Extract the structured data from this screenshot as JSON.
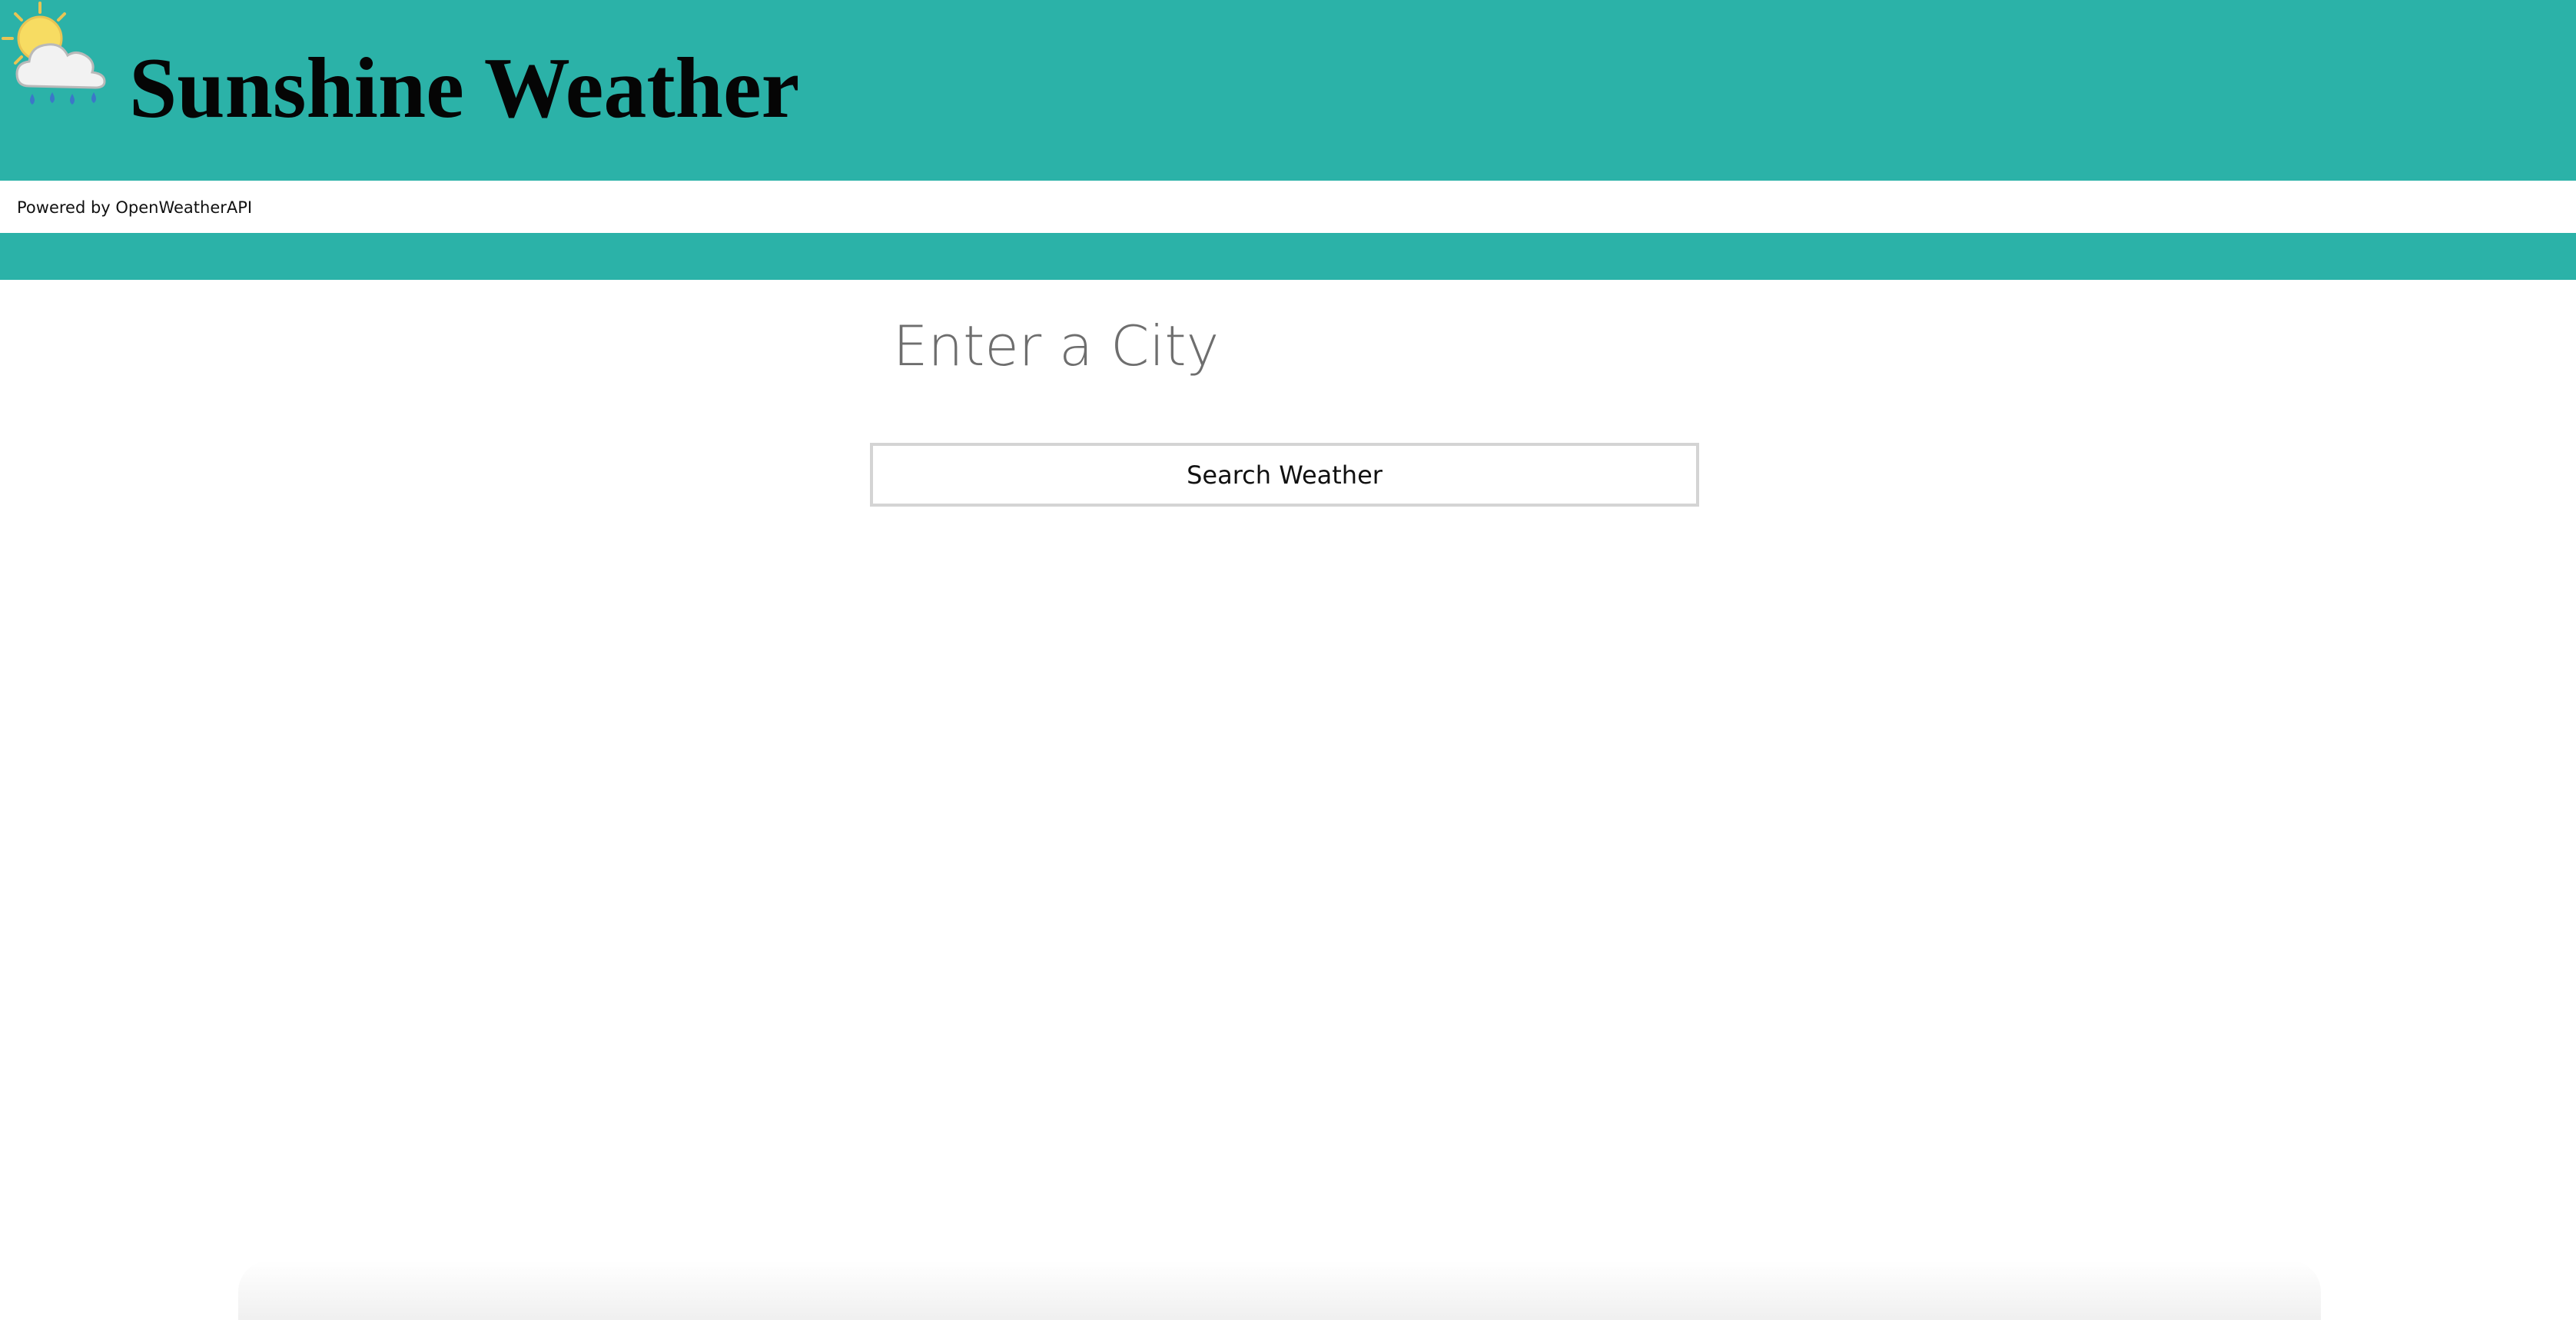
{
  "header": {
    "title": "Sunshine Weather",
    "logo_icon": "sun-cloud-rain-icon",
    "background_color": "#2bb2a8"
  },
  "powered_by": {
    "text": "Powered by OpenWeatherAPI"
  },
  "search": {
    "placeholder": "Enter a City",
    "value": "",
    "button_label": "Search Weather"
  }
}
